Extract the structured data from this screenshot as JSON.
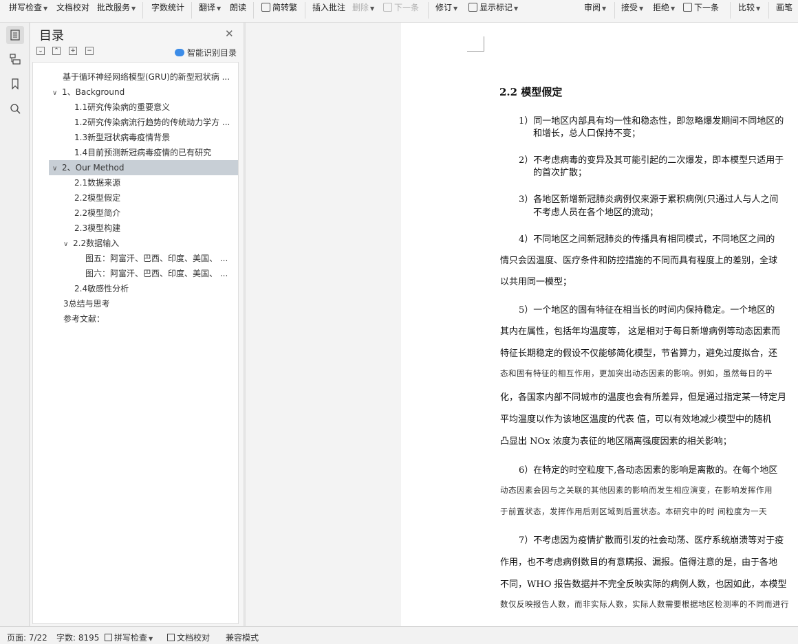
{
  "ribbon": {
    "spell_check": "拼写检查",
    "doc_proofread": "文档校对",
    "review_service": "批改服务",
    "word_count": "字数统计",
    "translate": "翻译",
    "read_aloud": "朗读",
    "trad_simp": "简转繁",
    "insert_comment": "插入批注",
    "delete": "删除",
    "next_item": "下一条",
    "track_changes": "修订",
    "show_markup": "显示标记",
    "review": "审阅",
    "accept": "接受",
    "reject": "拒绝",
    "next_change": "下一条",
    "compare": "比较",
    "pen": "画笔"
  },
  "toc": {
    "title": "目录",
    "smart_toc": "智能识别目录",
    "items": [
      {
        "label": "基于循环神经网络模型(GRU)的新型冠状病 ..."
      },
      {
        "label": "1、Background"
      },
      {
        "label": "1.1研究传染病的重要意义"
      },
      {
        "label": "1.2研究传染病流行趋势的传统动力学方 ..."
      },
      {
        "label": "1.3新型冠状病毒疫情背景"
      },
      {
        "label": "1.4目前预测新冠病毒疫情的已有研究"
      },
      {
        "label": "2、Our Method"
      },
      {
        "label": "2.1数据来源"
      },
      {
        "label": "2.2模型假定"
      },
      {
        "label": "2.2模型简介"
      },
      {
        "label": "2.3模型构建"
      },
      {
        "label": "2.2数据输入"
      },
      {
        "label": "图五：阿富汗、巴西、印度、美国、 ..."
      },
      {
        "label": "图六：阿富汗、巴西、印度、美国、 ..."
      },
      {
        "label": "2.4敏感性分析"
      },
      {
        "label": "3总结与思考"
      },
      {
        "label": "参考文献："
      }
    ]
  },
  "document": {
    "heading": "2.2  模型假定",
    "lines": [
      "1）同一地区内部具有均一性和稳态性，即忽略爆发期间不同地区的",
      "和增长，总人口保持不变；",
      "2）不考虑病毒的变异及其可能引起的二次爆发，即本模型只适用于",
      "的首次扩散；",
      "3）各地区新增新冠肺炎病例仅来源于累积病例(只通过人与人之间",
      "不考虑人员在各个地区的流动；",
      "4）不同地区之间新冠肺炎的传播具有相同模式，不同地区之间的",
      "情只会因温度、医疗条件和防控措施的不同而具有程度上的差别，全球",
      "以共用同一模型；",
      "5）一个地区的固有特征在相当长的时间内保持稳定。一个地区的",
      "其内在属性，包括年均温度等，  这是相对于每日新增病例等动态因素而",
      "特征长期稳定的假设不仅能够简化模型，节省算力，避免过度拟合，还",
      "态和固有特征的相互作用，更加突出动态因素的影响。例如，虽然每日的平",
      "化，各国家内部不同城市的温度也会有所差异，但是通过指定某一特定月",
      "平均温度以作为该地区温度的代表   值，可以有效地减少模型中的随机",
      "凸显出 NOx 浓度为表征的地区隔离强度因素的相关影响；",
      "6）在特定的时空粒度下,各动态因素的影响是离散的。在每个地区",
      "动态因素会因与之关联的其他因素的影响而发生相应演变，在影响发挥作用",
      "于前置状态，发挥作用后则区域到后置状态。本研究中的时       间粒度为一天",
      "7）不考虑因为疫情扩散而引发的社会动荡、医疗系统崩溃等对于疫",
      "作用，也不考虑病例数目的有意瞒报、漏报。值得注意的是，由于各地",
      "不同，WHO 报告数据并不完全反映实际的病例人数，也因如此，本模型",
      "数仅反映报告人数，而非实际人数，实际人数需要根据地区检测率的不同而进行"
    ]
  },
  "status": {
    "page": "页面: 7/22",
    "words": "字数: 8195",
    "spell_check": "拼写检查",
    "doc_proofread": "文档校对",
    "compat_mode": "兼容模式"
  }
}
